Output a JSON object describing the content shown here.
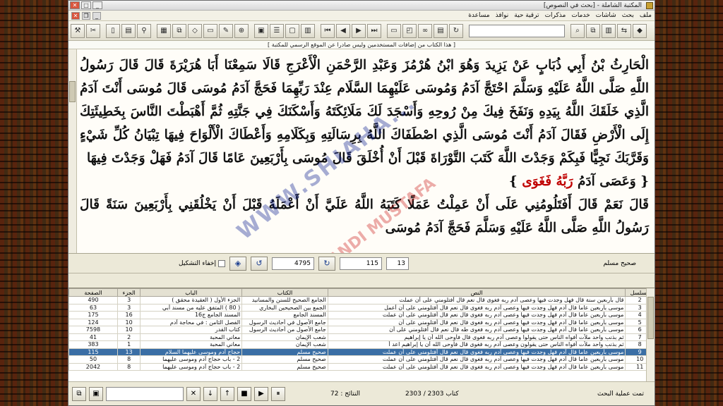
{
  "window": {
    "title": "المكتبة الشاملة - [بحث في النصوص]"
  },
  "menu": {
    "items": [
      "ملف",
      "بحث",
      "شاشات",
      "خدمات",
      "مذكرات",
      "ترقية حية",
      "نوافذ",
      "مساعدة"
    ]
  },
  "notice": "[ هذا الكتاب من إضافات المستخدمين وليس صادرا عن الموقع الرسمي للمكتبة ]",
  "reader": {
    "lines": [
      "الْحَارِثُ بْنُ أَبِي ذُبَابٍ عَنْ يَزِيدَ وَهُوَ ابْنُ هُرْمُزَ وَعَبْدِ الرَّحْمَنِ الْأَعْرَجِ قَالَا سَمِعْنَا أَبَا هُرَيْرَةَ قَالَ",
      "قَالَ رَسُولُ اللَّهِ صَلَّى اللَّهُ عَلَيْهِ وَسَلَّمَ احْتَجَّ آدَمُ وَمُوسَى عَلَيْهِمَا السَّلَام عِنْدَ رَبِّهِمَا فَحَجَّ آدَمُ مُوسَى قَالَ مُوسَى أَنْتَ آدَمُ الَّذِي",
      "خَلَقَكَ اللَّهُ بِيَدِهِ وَنَفَخَ فِيكَ مِنْ رُوحِهِ وَأَسْجَدَ لَكَ مَلَائِكَتَهُ وَأَسْكَنَكَ فِي جَنَّتِهِ ثُمَّ أَهْبَطْتَ النَّاسَ بِخَطِيئَتِكَ إِلَى الْأَرْضِ فَقَالَ",
      "آدَمُ أَنْتَ مُوسَى الَّذِي اصْطَفَاكَ اللَّهُ بِرِسَالَتِهِ وَبِكَلَامِهِ وَأَعْطَاكَ الْأَلْوَاحَ فِيهَا تِبْيَانُ كُلِّ شَيْءٍ وَقَرَّبَكَ نَجِيًّا فَبِكَمْ وَجَدْتَ اللَّهَ كَتَبَ",
      "التَّوْرَاةَ قَبْلَ أَنْ أُخْلَقَ قَالَ مُوسَى بِأَرْبَعِينَ عَامًا قَالَ آدَمُ فَهَلْ وَجَدْتَ فِيهَا"
    ],
    "verse_prefix": "{ وَعَصَى آدَمُ",
    "verse_red": "رَبَّهُ فَغَوَى",
    "verse_suffix": "}",
    "lines2": [
      "قَالَ نَعَمْ قَالَ أَفَتَلُومُنِي عَلَى أَنْ عَمِلْتُ عَمَلًا كَتَبَهُ اللَّهُ عَلَيَّ أَنْ أَعْمَلَهُ قَبْلَ أَنْ يَخْلُقَنِي بِأَرْبَعِينَ سَنَةً قَالَ رَسُولُ اللَّهِ صَلَّى اللَّهُ",
      "عَلَيْهِ وَسَلَّمَ فَحَجَّ آدَمُ مُوسَى"
    ],
    "watermark": "WWW.SHIAHA...",
    "watermark2": "...RZANDI MUSTAFA"
  },
  "controls": {
    "hide_tashkeel_label": "إخفاء التشكيل",
    "field_left": "4795",
    "field_mid": "115",
    "field_right": "13",
    "book_name": "صحيح مسلم"
  },
  "table": {
    "headers": [
      "الصفحة",
      "الجزء",
      "الباب",
      "الكتاب",
      "النص",
      "مسلسل"
    ],
    "rows": [
      [
        "490",
        "3",
        "الجزء الأول ( العقيدة محقق )",
        "الجامع الصحيح للسنن والمسانيد",
        "قال بأربعين سنة قال فهل وجدت فيها وعصى آدم ربه فغوى قال نعم قال أفتلومني على أن عملت",
        "2"
      ],
      [
        "63",
        "3",
        "( 80 ) المتفق عليه من مسند أبي",
        "الجمع بين الصحيحين البخاري",
        "موسى بأربعين عاما قال آدم فهل وجدت فيها وعصى آدم ربه فغوى قال نعم قال أفتلومني على أن أعمل",
        "3"
      ],
      [
        "175",
        "16",
        "المسند الجامع ج16",
        "المسند الجامع",
        "موسى بأربعين عاما قال آدم فهل وجدت فيها وعصى آدم ربه فغوى قال نعم قال أفتلومني على أن عملت",
        "4"
      ],
      [
        "124",
        "10",
        "الفصل الثامن : في محاجة آدم",
        "جامع الأصول في أحاديث الرسول",
        "موسى بأربعين عاما قال آدم فهل وجدت فيها وعصى آدم ربه فغوى قال نعم قال أفتلومني على أن",
        "5"
      ],
      [
        "7598",
        "10",
        "كتاب القدر",
        "جامع الأصول من أحاديث الرسول",
        "موسى بأربعين عاما قال آدم فهل وجدت فيها وعصى آدم ربه فغوى طه قال نعم قال أفتلومني على أن",
        "6"
      ],
      [
        "41",
        "2",
        "معاني المحبة",
        "شعب الإيمان",
        "ثم بذنب واحد ملأت أفواه الناس حتى يقولوا وعصى آدم ربه فغوى قال فأوحى الله أن يا إبراهيم",
        "7"
      ],
      [
        "383",
        "1",
        "معاني المحبة",
        "شعب الإيمان",
        "ثم بذنب واحد ملأت أفواه الناس حتى يقولون وعصى آدم ربه فغوى قال فأوحى الله أن يا إبراهيم اعد أ",
        "8"
      ],
      [
        "115",
        "13",
        "حجاج آدم وموسى عليهما السلام",
        "صحيح مسلم",
        "موسى بأربعين عاما قال آدم فهل وجدت فيها وعصى آدم ربه فغوى قال نعم قال أفتلومني على أن عملت",
        "9"
      ],
      [
        "50",
        "8",
        "2 - باب حجاج آدم وموسى عليهما",
        "صحيح مسلم",
        "موسى بأربعين عاما قال آدم فهل وجدت فيها وعصى آدم ربه فغوى قال نعم قال أفتلومني على أن عملت",
        "10"
      ],
      [
        "2042",
        "8",
        "2 - باب حجاج آدم وموسى عليهما",
        "صحيح مسلم",
        "موسى بأربعين عاما قال آدم فهل وجدت فيها وعصى آدم ربه فغوى قال نعم قال أفتلومني على أن عملت",
        "11"
      ]
    ],
    "selected_index": 7
  },
  "statusbar": {
    "results": "النتائج : 72",
    "books": "كتاب 2303 / 2303",
    "done": "تمت عملية البحث"
  }
}
